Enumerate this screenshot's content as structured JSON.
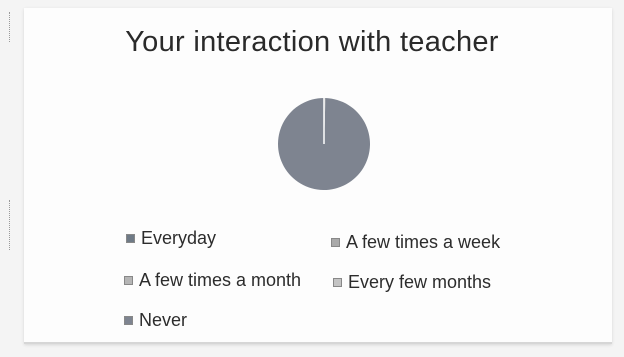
{
  "chart_data": {
    "type": "pie",
    "title": "Your interaction with teacher",
    "categories": [
      "Everyday",
      "A few times a week",
      "A few times a month",
      "Every few months",
      "Never"
    ],
    "values": [
      0,
      0.5,
      0,
      0,
      99.5
    ],
    "colors": [
      "#6f7a86",
      "#a9a9a9",
      "#b5b5b5",
      "#c4c4c4",
      "#7e8490"
    ],
    "legend": "bottom"
  }
}
